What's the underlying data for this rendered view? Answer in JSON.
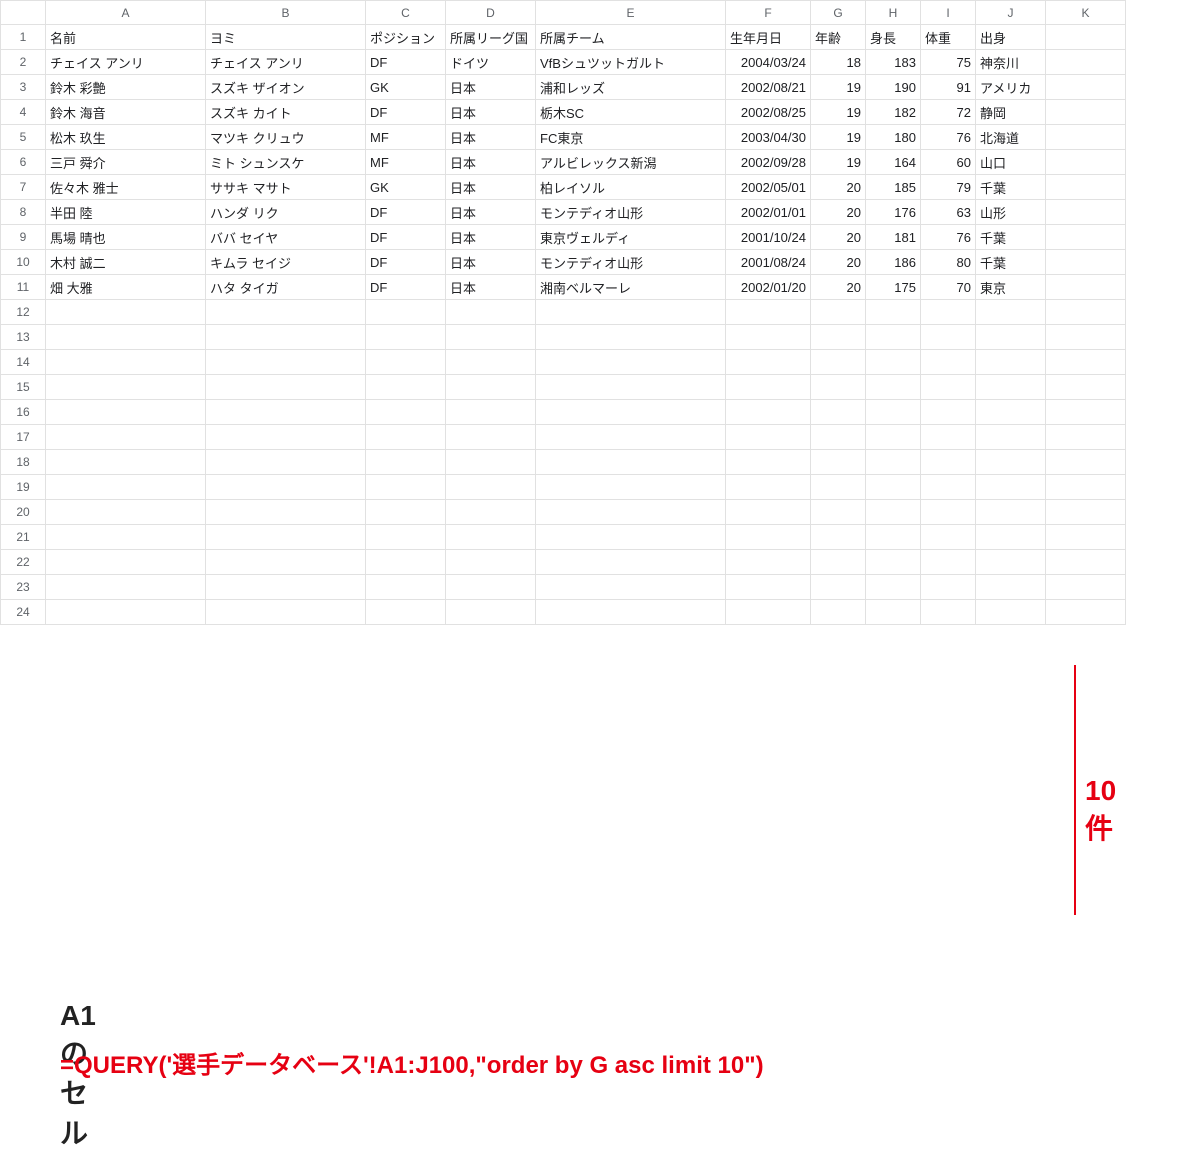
{
  "columns": [
    "A",
    "B",
    "C",
    "D",
    "E",
    "F",
    "G",
    "H",
    "I",
    "J",
    "K"
  ],
  "headers": {
    "A": "名前",
    "B": "ヨミ",
    "C": "ポジション",
    "D": "所属リーグ国",
    "E": "所属チーム",
    "F": "生年月日",
    "G": "年齢",
    "H": "身長",
    "I": "体重",
    "J": "出身",
    "K": ""
  },
  "rows": [
    {
      "A": "チェイス アンリ",
      "B": "チェイス アンリ",
      "C": "DF",
      "D": "ドイツ",
      "E": "VfBシュツットガルト",
      "F": "2004/03/24",
      "G": "18",
      "H": "183",
      "I": "75",
      "J": "神奈川",
      "K": ""
    },
    {
      "A": "鈴木 彩艶",
      "B": "スズキ ザイオン",
      "C": "GK",
      "D": "日本",
      "E": "浦和レッズ",
      "F": "2002/08/21",
      "G": "19",
      "H": "190",
      "I": "91",
      "J": "アメリカ",
      "K": ""
    },
    {
      "A": "鈴木 海音",
      "B": "スズキ カイト",
      "C": "DF",
      "D": "日本",
      "E": "栃木SC",
      "F": "2002/08/25",
      "G": "19",
      "H": "182",
      "I": "72",
      "J": "静岡",
      "K": ""
    },
    {
      "A": "松木 玖生",
      "B": "マツキ クリュウ",
      "C": "MF",
      "D": "日本",
      "E": "FC東京",
      "F": "2003/04/30",
      "G": "19",
      "H": "180",
      "I": "76",
      "J": "北海道",
      "K": ""
    },
    {
      "A": "三戸 舜介",
      "B": "ミト シュンスケ",
      "C": "MF",
      "D": "日本",
      "E": "アルビレックス新潟",
      "F": "2002/09/28",
      "G": "19",
      "H": "164",
      "I": "60",
      "J": "山口",
      "K": ""
    },
    {
      "A": "佐々木 雅士",
      "B": "ササキ マサト",
      "C": "GK",
      "D": "日本",
      "E": "柏レイソル",
      "F": "2002/05/01",
      "G": "20",
      "H": "185",
      "I": "79",
      "J": "千葉",
      "K": ""
    },
    {
      "A": "半田 陸",
      "B": "ハンダ リク",
      "C": "DF",
      "D": "日本",
      "E": "モンテディオ山形",
      "F": "2002/01/01",
      "G": "20",
      "H": "176",
      "I": "63",
      "J": "山形",
      "K": ""
    },
    {
      "A": "馬場 晴也",
      "B": "ババ セイヤ",
      "C": "DF",
      "D": "日本",
      "E": "東京ヴェルディ",
      "F": "2001/10/24",
      "G": "20",
      "H": "181",
      "I": "76",
      "J": "千葉",
      "K": ""
    },
    {
      "A": "木村 誠二",
      "B": "キムラ セイジ",
      "C": "DF",
      "D": "日本",
      "E": "モンテディオ山形",
      "F": "2001/08/24",
      "G": "20",
      "H": "186",
      "I": "80",
      "J": "千葉",
      "K": ""
    },
    {
      "A": "畑 大雅",
      "B": "ハタ タイガ",
      "C": "DF",
      "D": "日本",
      "E": "湘南ベルマーレ",
      "F": "2002/01/20",
      "G": "20",
      "H": "175",
      "I": "70",
      "J": "東京",
      "K": ""
    }
  ],
  "totalRows": 24,
  "numericCols": [
    "F",
    "G",
    "H",
    "I"
  ],
  "annotations": {
    "count_label": "10件",
    "cell_label": "A1のセル",
    "formula": "=QUERY('選手データベース'!A1:J100,\"order by G asc limit 10\")"
  }
}
